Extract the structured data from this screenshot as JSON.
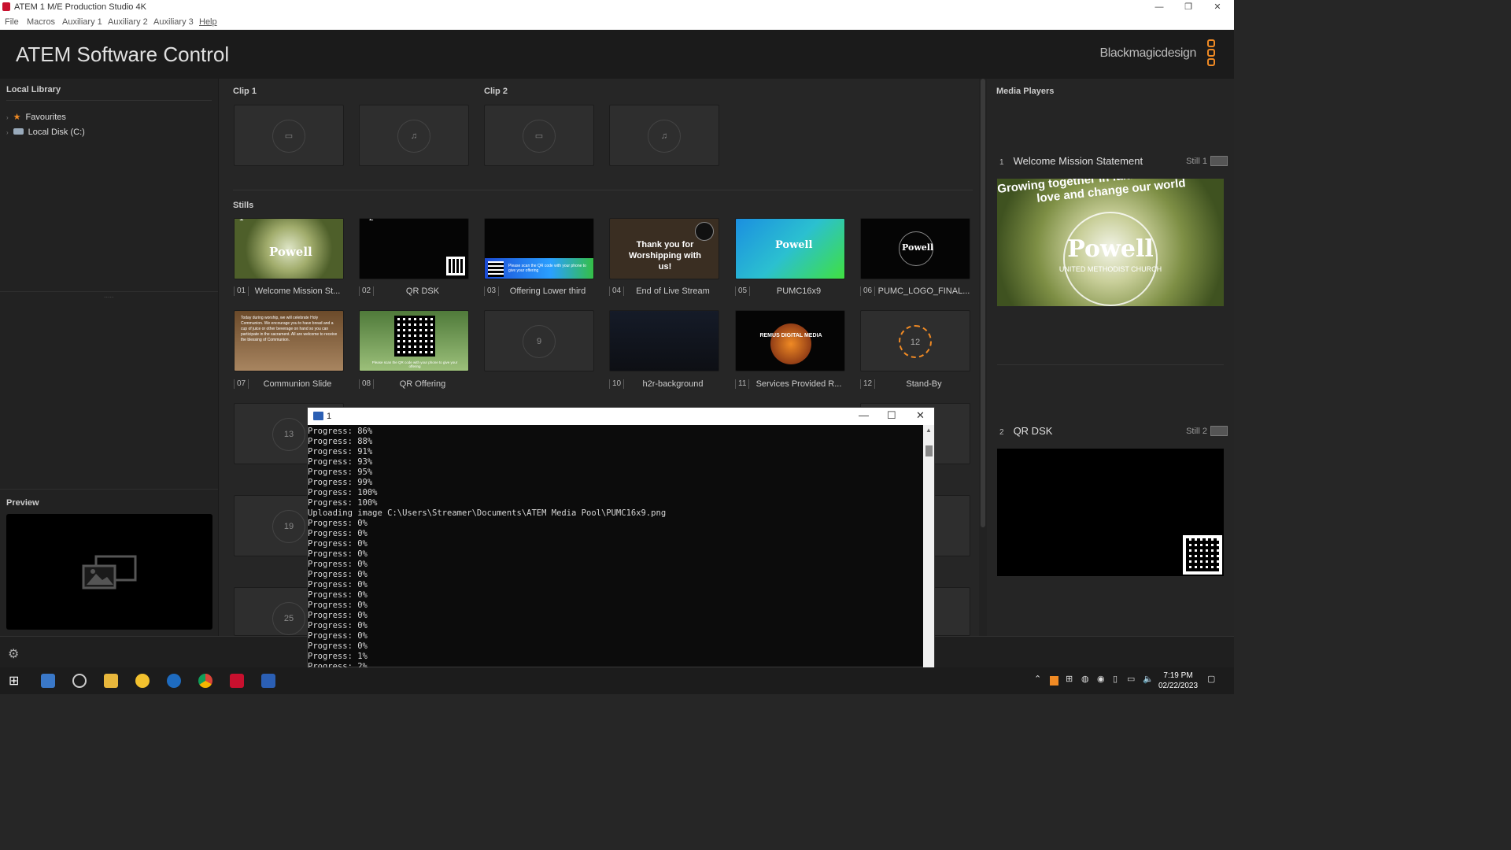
{
  "window": {
    "title": "ATEM 1 M/E Production Studio 4K",
    "minimize": "—",
    "restore": "❐",
    "close": "✕"
  },
  "menu": [
    "File",
    "Macros",
    "Auxiliary 1",
    "Auxiliary 2",
    "Auxiliary 3",
    "Help"
  ],
  "header": {
    "app_title": "ATEM Software Control",
    "brand": "Blackmagicdesign"
  },
  "library": {
    "title": "Local Library",
    "items": [
      {
        "label": "Favourites",
        "icon": "star-icon"
      },
      {
        "label": "Local Disk (C:)",
        "icon": "drive-icon"
      }
    ],
    "preview_title": "Preview",
    "splitter": "....."
  },
  "clips": {
    "clip1": "Clip 1",
    "clip2": "Clip 2"
  },
  "stills": {
    "title": "Stills",
    "items": [
      {
        "num": "01",
        "name": "Welcome Mission St...",
        "badge": "1"
      },
      {
        "num": "02",
        "name": "QR DSK",
        "badge": "2"
      },
      {
        "num": "03",
        "name": "Offering Lower third"
      },
      {
        "num": "04",
        "name": "End of Live Stream"
      },
      {
        "num": "05",
        "name": "PUMC16x9"
      },
      {
        "num": "06",
        "name": "PUMC_LOGO_FINAL..."
      },
      {
        "num": "07",
        "name": "Communion Slide"
      },
      {
        "num": "08",
        "name": "QR Offering"
      },
      {
        "num": "9",
        "name": ""
      },
      {
        "num": "10",
        "name": "h2r-background"
      },
      {
        "num": "11",
        "name": "Services Provided R..."
      },
      {
        "num": "12",
        "name": "Stand-By"
      }
    ],
    "empty_slots": [
      "13",
      "19",
      "25"
    ]
  },
  "thumb_text": {
    "powell": "Powell",
    "thank": "Thank you for Worshipping with us!",
    "lower": "Please scan the QR code with your phone to give your offering",
    "communion": "Today during worship, we will celebrate Holy Communion. We encourage you to have bread and a cup of juice or other beverage on hand so you can participate in the sacrament. All are welcome to receive the blessing of Communion.",
    "qroffering": "Please scan the QR code with your phone to give your offering",
    "remus": "REMUS DIGITAL MEDIA"
  },
  "media_players": {
    "title": "Media Players",
    "players": [
      {
        "idx": "1",
        "name": "Welcome Mission Statement",
        "still": "Still 1"
      },
      {
        "idx": "2",
        "name": "QR DSK",
        "still": "Still 2"
      }
    ],
    "powell_big": "Powell",
    "umc": "UNITED METHODIST CHURCH",
    "ring": "Growing together in faith to share God's love and change our world"
  },
  "console": {
    "title": "1",
    "lines": [
      "Progress: 86%",
      "Progress: 88%",
      "Progress: 91%",
      "Progress: 93%",
      "Progress: 95%",
      "Progress: 99%",
      "Progress: 100%",
      "Progress: 100%",
      "Uploading image C:\\Users\\Streamer\\Documents\\ATEM Media Pool\\PUMC16x9.png",
      "Progress: 0%",
      "Progress: 0%",
      "Progress: 0%",
      "Progress: 0%",
      "Progress: 0%",
      "Progress: 0%",
      "Progress: 0%",
      "Progress: 0%",
      "Progress: 0%",
      "Progress: 0%",
      "Progress: 0%",
      "Progress: 0%",
      "Progress: 0%",
      "Progress: 1%",
      "Progress: 2%"
    ]
  },
  "taskbar": {
    "time": "7:19 PM",
    "date": "02/22/2023"
  },
  "colors": {
    "accent": "#f08a24",
    "bg": "#262626"
  }
}
